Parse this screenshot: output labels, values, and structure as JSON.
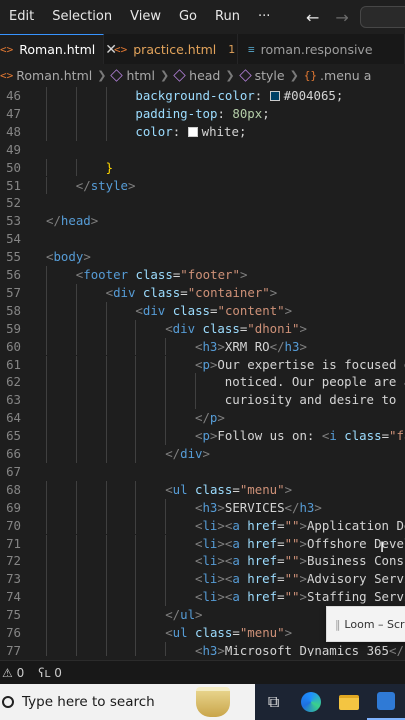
{
  "menubar": {
    "items": [
      "Edit",
      "Selection",
      "View",
      "Go",
      "Run",
      "···"
    ],
    "back_arrow": "←",
    "forward_arrow": "→"
  },
  "tabs": [
    {
      "icon": "<>",
      "label": "Roman.html",
      "close": "✕"
    },
    {
      "icon": "<>",
      "label": "practice.html",
      "badge": "1"
    },
    {
      "icon": "≡",
      "label": "roman.responsive"
    }
  ],
  "breadcrumb": {
    "file_icon": "<>",
    "file": "Roman.html",
    "items": [
      "html",
      "head",
      "style"
    ],
    "selector_icon": "{}",
    "selector": ".menu a"
  },
  "editor": {
    "lines": [
      {
        "n": "46",
        "i": 3,
        "t": [
          [
            "pr",
            "background-color"
          ],
          [
            "pu",
            ": "
          ],
          [
            "sw",
            "#004065"
          ],
          [
            "tx",
            "#004065"
          ],
          [
            "pu",
            ";"
          ]
        ]
      },
      {
        "n": "47",
        "i": 3,
        "t": [
          [
            "pr",
            "padding-top"
          ],
          [
            "pu",
            ": "
          ],
          [
            "nm",
            "80px"
          ],
          [
            "pu",
            ";"
          ]
        ]
      },
      {
        "n": "48",
        "i": 3,
        "t": [
          [
            "pr",
            "color"
          ],
          [
            "pu",
            ": "
          ],
          [
            "sw",
            "#ffffff"
          ],
          [
            "tx",
            "white"
          ],
          [
            "pu",
            ";"
          ]
        ]
      },
      {
        "n": "49",
        "i": 0,
        "t": []
      },
      {
        "n": "50",
        "i": 2,
        "t": [
          [
            "br",
            "}"
          ]
        ]
      },
      {
        "n": "51",
        "i": 1,
        "t": [
          [
            "tg",
            "</"
          ],
          [
            "tn",
            "style"
          ],
          [
            "tg",
            ">"
          ]
        ]
      },
      {
        "n": "52",
        "i": 0,
        "t": []
      },
      {
        "n": "53",
        "i": 0,
        "t": [
          [
            "tg",
            "</"
          ],
          [
            "tn",
            "head"
          ],
          [
            "tg",
            ">"
          ]
        ]
      },
      {
        "n": "54",
        "i": 0,
        "t": []
      },
      {
        "n": "55",
        "i": 0,
        "t": [
          [
            "tg",
            "<"
          ],
          [
            "tn",
            "body"
          ],
          [
            "tg",
            ">"
          ]
        ]
      },
      {
        "n": "56",
        "i": 1,
        "t": [
          [
            "tg",
            "<"
          ],
          [
            "tn",
            "footer"
          ],
          [
            "tx",
            " "
          ],
          [
            "at",
            "class"
          ],
          [
            "pu",
            "="
          ],
          [
            "st",
            "\"footer\""
          ],
          [
            "tg",
            ">"
          ]
        ]
      },
      {
        "n": "57",
        "i": 2,
        "t": [
          [
            "tg",
            "<"
          ],
          [
            "tn",
            "div"
          ],
          [
            "tx",
            " "
          ],
          [
            "at",
            "class"
          ],
          [
            "pu",
            "="
          ],
          [
            "st",
            "\"container\""
          ],
          [
            "tg",
            ">"
          ]
        ]
      },
      {
        "n": "58",
        "i": 3,
        "t": [
          [
            "tg",
            "<"
          ],
          [
            "tn",
            "div"
          ],
          [
            "tx",
            " "
          ],
          [
            "at",
            "class"
          ],
          [
            "pu",
            "="
          ],
          [
            "st",
            "\"content\""
          ],
          [
            "tg",
            ">"
          ]
        ]
      },
      {
        "n": "59",
        "i": 4,
        "t": [
          [
            "tg",
            "<"
          ],
          [
            "tn",
            "div"
          ],
          [
            "tx",
            " "
          ],
          [
            "at",
            "class"
          ],
          [
            "pu",
            "="
          ],
          [
            "st",
            "\"dhoni\""
          ],
          [
            "tg",
            ">"
          ]
        ]
      },
      {
        "n": "60",
        "i": 5,
        "t": [
          [
            "tg",
            "<"
          ],
          [
            "tn",
            "h3"
          ],
          [
            "tg",
            ">"
          ],
          [
            "tx",
            "XRM RO"
          ],
          [
            "tg",
            "</"
          ],
          [
            "tn",
            "h3"
          ],
          [
            "tg",
            ">"
          ]
        ]
      },
      {
        "n": "61",
        "i": 5,
        "t": [
          [
            "tg",
            "<"
          ],
          [
            "tn",
            "p"
          ],
          [
            "tg",
            ">"
          ],
          [
            "tx",
            "Our expertise is focused on"
          ]
        ]
      },
      {
        "n": "62",
        "i": 6,
        "t": [
          [
            "tx",
            "noticed. Our people are agi"
          ]
        ]
      },
      {
        "n": "63",
        "i": 6,
        "t": [
          [
            "tx",
            "curiosity and desire to sol"
          ]
        ]
      },
      {
        "n": "64",
        "i": 5,
        "t": [
          [
            "tg",
            "</"
          ],
          [
            "tn",
            "p"
          ],
          [
            "tg",
            ">"
          ]
        ]
      },
      {
        "n": "65",
        "i": 5,
        "t": [
          [
            "tg",
            "<"
          ],
          [
            "tn",
            "p"
          ],
          [
            "tg",
            ">"
          ],
          [
            "tx",
            "Follow us on: "
          ],
          [
            "tg",
            "<"
          ],
          [
            "tn",
            "i"
          ],
          [
            "tx",
            " "
          ],
          [
            "at",
            "class"
          ],
          [
            "pu",
            "="
          ],
          [
            "st",
            "\"fa-"
          ]
        ]
      },
      {
        "n": "66",
        "i": 4,
        "t": [
          [
            "tg",
            "</"
          ],
          [
            "tn",
            "div"
          ],
          [
            "tg",
            ">"
          ]
        ]
      },
      {
        "n": "67",
        "i": 0,
        "t": []
      },
      {
        "n": "68",
        "i": 4,
        "t": [
          [
            "tg",
            "<"
          ],
          [
            "tn",
            "ul"
          ],
          [
            "tx",
            " "
          ],
          [
            "at",
            "class"
          ],
          [
            "pu",
            "="
          ],
          [
            "st",
            "\"menu\""
          ],
          [
            "tg",
            ">"
          ]
        ]
      },
      {
        "n": "69",
        "i": 5,
        "t": [
          [
            "tg",
            "<"
          ],
          [
            "tn",
            "h3"
          ],
          [
            "tg",
            ">"
          ],
          [
            "tx",
            "SERVICES"
          ],
          [
            "tg",
            "</"
          ],
          [
            "tn",
            "h3"
          ],
          [
            "tg",
            ">"
          ]
        ]
      },
      {
        "n": "70",
        "i": 5,
        "t": [
          [
            "tg",
            "<"
          ],
          [
            "tn",
            "li"
          ],
          [
            "tg",
            "><"
          ],
          [
            "tn",
            "a"
          ],
          [
            "tx",
            " "
          ],
          [
            "at",
            "href"
          ],
          [
            "pu",
            "="
          ],
          [
            "st",
            "\"\""
          ],
          [
            "tg",
            ">"
          ],
          [
            "tx",
            "Application Deve"
          ]
        ]
      },
      {
        "n": "71",
        "i": 5,
        "t": [
          [
            "tg",
            "<"
          ],
          [
            "tn",
            "li"
          ],
          [
            "tg",
            "><"
          ],
          [
            "tn",
            "a"
          ],
          [
            "tx",
            " "
          ],
          [
            "at",
            "href"
          ],
          [
            "pu",
            "="
          ],
          [
            "st",
            "\"\""
          ],
          [
            "tg",
            ">"
          ],
          [
            "tx",
            "Offshore Develo"
          ]
        ]
      },
      {
        "n": "72",
        "i": 5,
        "t": [
          [
            "tg",
            "<"
          ],
          [
            "tn",
            "li"
          ],
          [
            "tg",
            "><"
          ],
          [
            "tn",
            "a"
          ],
          [
            "tx",
            " "
          ],
          [
            "at",
            "href"
          ],
          [
            "pu",
            "="
          ],
          [
            "st",
            "\"\""
          ],
          [
            "tg",
            ">"
          ],
          [
            "tx",
            "Business Consul"
          ]
        ]
      },
      {
        "n": "73",
        "i": 5,
        "t": [
          [
            "tg",
            "<"
          ],
          [
            "tn",
            "li"
          ],
          [
            "tg",
            "><"
          ],
          [
            "tn",
            "a"
          ],
          [
            "tx",
            " "
          ],
          [
            "at",
            "href"
          ],
          [
            "pu",
            "="
          ],
          [
            "st",
            "\"\""
          ],
          [
            "tg",
            ">"
          ],
          [
            "tx",
            "Advisory Servic"
          ]
        ]
      },
      {
        "n": "74",
        "i": 5,
        "t": [
          [
            "tg",
            "<"
          ],
          [
            "tn",
            "li"
          ],
          [
            "tg",
            "><"
          ],
          [
            "tn",
            "a"
          ],
          [
            "tx",
            " "
          ],
          [
            "at",
            "href"
          ],
          [
            "pu",
            "="
          ],
          [
            "st",
            "\"\""
          ],
          [
            "tg",
            ">"
          ],
          [
            "tx",
            "Staffing Servic"
          ]
        ]
      },
      {
        "n": "75",
        "i": 4,
        "t": [
          [
            "tg",
            "</"
          ],
          [
            "tn",
            "ul"
          ],
          [
            "tg",
            ">"
          ]
        ]
      },
      {
        "n": "76",
        "i": 4,
        "t": [
          [
            "tg",
            "<"
          ],
          [
            "tn",
            "ul"
          ],
          [
            "tx",
            " "
          ],
          [
            "at",
            "class"
          ],
          [
            "pu",
            "="
          ],
          [
            "st",
            "\"menu\""
          ],
          [
            "tg",
            ">"
          ]
        ]
      },
      {
        "n": "77",
        "i": 5,
        "t": [
          [
            "tg",
            "<"
          ],
          [
            "tn",
            "h3"
          ],
          [
            "tg",
            ">"
          ],
          [
            "tx",
            "Microsoft Dynamics 365"
          ],
          [
            "tg",
            "</"
          ],
          [
            "tn",
            "h3"
          ],
          [
            "tg",
            ">"
          ]
        ]
      }
    ]
  },
  "loom_popup": {
    "grip": "||",
    "label": "Loom – Scr"
  },
  "statusbar": {
    "errors_icon": "⊗",
    "errors": "0",
    "warnings_icon": "⚠",
    "warnings": "0",
    "ports_icon": "ʕʟ",
    "ports": "0"
  },
  "taskbar": {
    "search_placeholder": "Type here to search"
  }
}
